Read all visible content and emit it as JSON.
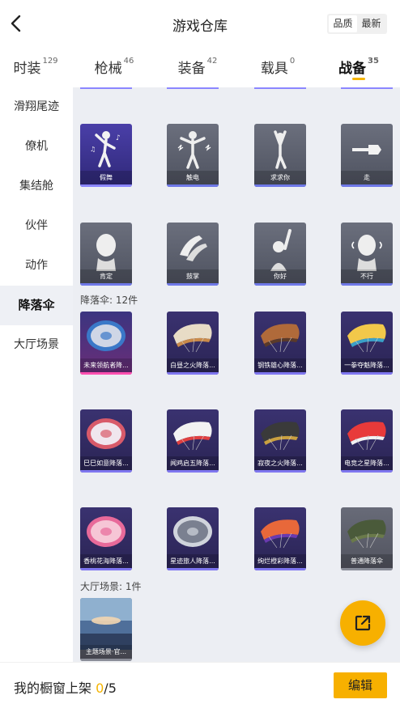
{
  "header": {
    "title": "游戏仓库",
    "sort_options": [
      "品质",
      "最新"
    ],
    "sort_selected": "品质"
  },
  "tabs": [
    {
      "label": "时装",
      "count": "129"
    },
    {
      "label": "枪械",
      "count": "46"
    },
    {
      "label": "装备",
      "count": "42"
    },
    {
      "label": "载具",
      "count": "0"
    },
    {
      "label": "战备",
      "count": "35",
      "active": true
    }
  ],
  "sidebar": {
    "items": [
      {
        "label": "滑翔尾迹"
      },
      {
        "label": "僚机"
      },
      {
        "label": "集结舱"
      },
      {
        "label": "伙伴"
      },
      {
        "label": "动作"
      },
      {
        "label": "降落伞",
        "active": true
      },
      {
        "label": "大厅场景"
      }
    ]
  },
  "emotes": {
    "items": [
      {
        "name": "假舞",
        "style": "purple",
        "icon": "dance-icon"
      },
      {
        "name": "触电",
        "style": "grey",
        "icon": "shock-icon"
      },
      {
        "name": "求求你",
        "style": "grey",
        "icon": "beg-icon"
      },
      {
        "name": "走",
        "style": "grey",
        "icon": "point-icon"
      },
      {
        "name": "肯定",
        "style": "grey",
        "icon": "nod-icon"
      },
      {
        "name": "鼓掌",
        "style": "grey",
        "icon": "clap-icon"
      },
      {
        "name": "你好",
        "style": "grey",
        "icon": "wave-icon"
      },
      {
        "name": "不行",
        "style": "grey",
        "icon": "shake-head-icon"
      }
    ]
  },
  "parachutes": {
    "label": "降落伞: 12件",
    "items": [
      {
        "name": "未来领航者降...",
        "style": "pink",
        "icon": "round-parachute-icon",
        "colors": [
          "#cfd6e6",
          "#3a78c8"
        ]
      },
      {
        "name": "白昼之火降落...",
        "style": "dark",
        "icon": "wing-parachute-icon",
        "colors": [
          "#e8dcc6",
          "#c98a4a"
        ]
      },
      {
        "name": "钢铁雄心降落...",
        "style": "dark",
        "icon": "wing-parachute-icon",
        "colors": [
          "#b06a3a",
          "#5a3a2a"
        ]
      },
      {
        "name": "一拳夺魁降落...",
        "style": "dark",
        "icon": "wing-parachute-icon",
        "colors": [
          "#f2c84a",
          "#3aa0c8"
        ]
      },
      {
        "name": "巳巳如意降落...",
        "style": "dark",
        "icon": "round-parachute-icon",
        "colors": [
          "#f0e6ee",
          "#d85a6a"
        ]
      },
      {
        "name": "闻鸡启五降落...",
        "style": "dark",
        "icon": "wing-parachute-icon",
        "colors": [
          "#f2f2f2",
          "#e04040"
        ]
      },
      {
        "name": "寂夜之火降落...",
        "style": "dark",
        "icon": "wing-parachute-icon",
        "colors": [
          "#3a3a3a",
          "#c9a040"
        ]
      },
      {
        "name": "电竞之星降落...",
        "style": "dark",
        "icon": "wing-parachute-icon",
        "colors": [
          "#e83a3a",
          "#f2f2f2"
        ]
      },
      {
        "name": "香桃花海降落...",
        "style": "dark",
        "icon": "round-parachute-icon",
        "colors": [
          "#f6c6d6",
          "#e86a9a"
        ]
      },
      {
        "name": "星迹旅人降落...",
        "style": "dark",
        "icon": "round-parachute-icon",
        "colors": [
          "#7a8090",
          "#d0d4dc"
        ]
      },
      {
        "name": "绚烂橙彩降落...",
        "style": "dark",
        "icon": "wing-parachute-icon",
        "colors": [
          "#e8683a",
          "#6a3ab0"
        ]
      },
      {
        "name": "普通降落伞",
        "style": "plain",
        "icon": "wing-parachute-icon",
        "colors": [
          "#4a5a3a",
          "#6a7a4a"
        ]
      }
    ]
  },
  "lobby": {
    "label": "大厅场景: 1件",
    "items": [
      {
        "name": "主题场景·官...",
        "style": "plain",
        "icon": "lobby-scene-icon"
      }
    ]
  },
  "bottom": {
    "label": "我的橱窗上架",
    "current": "0",
    "total": "/5",
    "edit_label": "编辑"
  },
  "fab": {
    "icon": "share-icon"
  }
}
